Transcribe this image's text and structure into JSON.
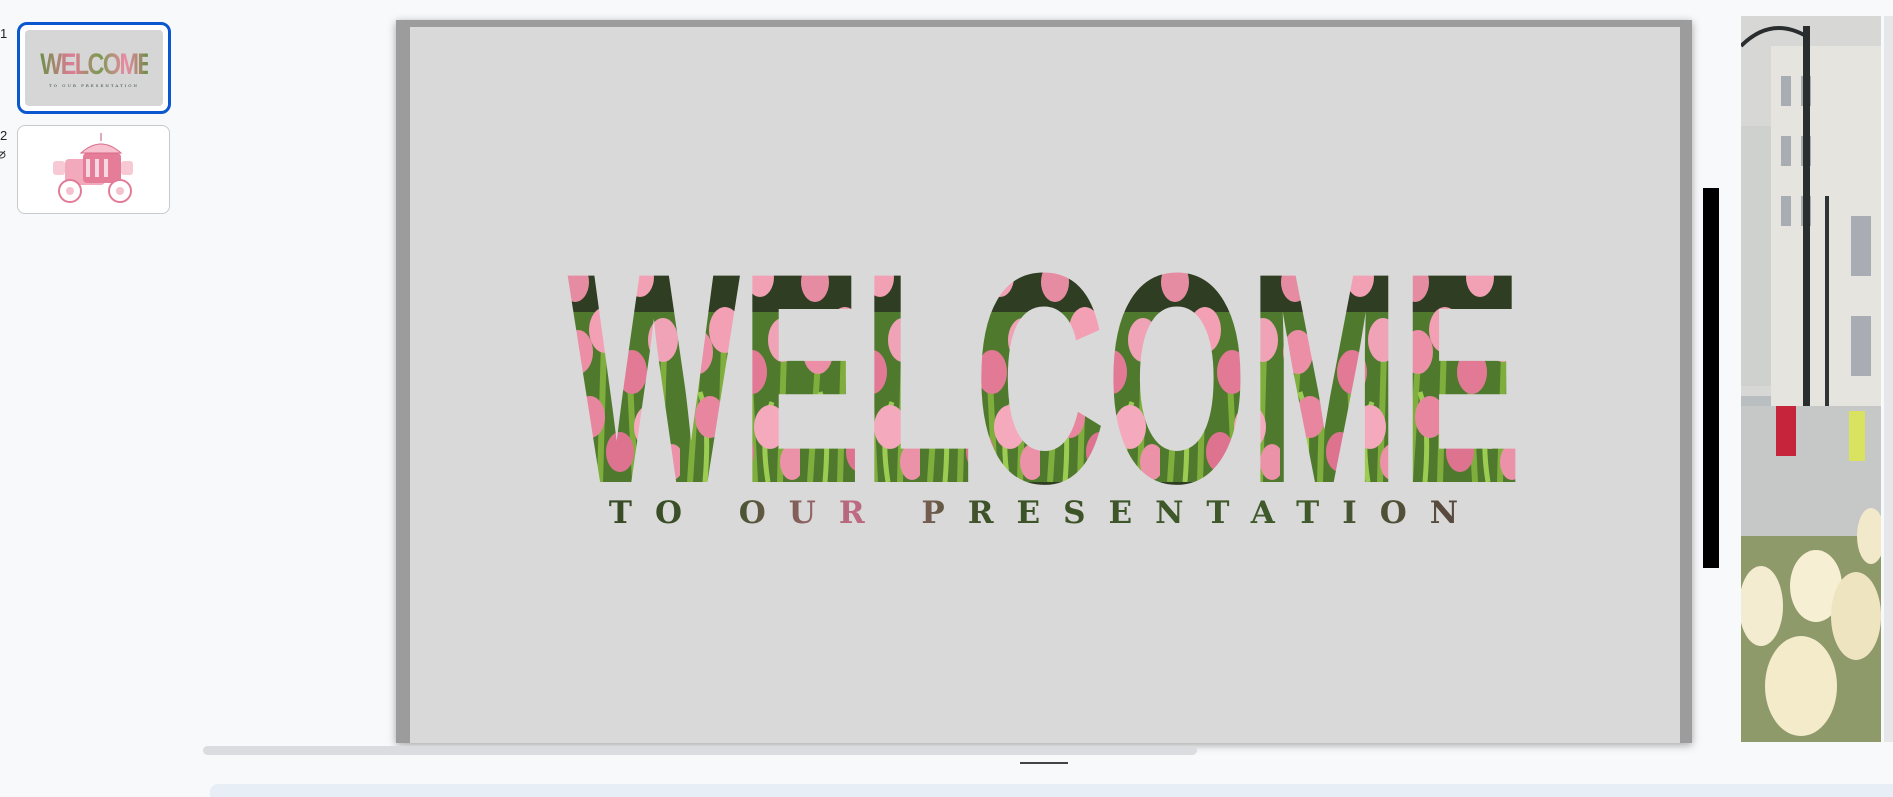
{
  "filmstrip": {
    "slides": [
      {
        "number": "1",
        "title": "WELCOME",
        "subtitle": "TO OUR PRESENTATION",
        "selected": true
      },
      {
        "number": "2",
        "hidden_icon": "eye-off-icon",
        "selected": false
      }
    ]
  },
  "slide": {
    "title": "WELCOME",
    "subtitle": "TO OUR PRESENTATION",
    "background": "#d9d9d9"
  },
  "colors": {
    "selection": "#0b57d0",
    "tulip_pink": "#e98aa2",
    "leaf_green": "#4f7a2e"
  }
}
